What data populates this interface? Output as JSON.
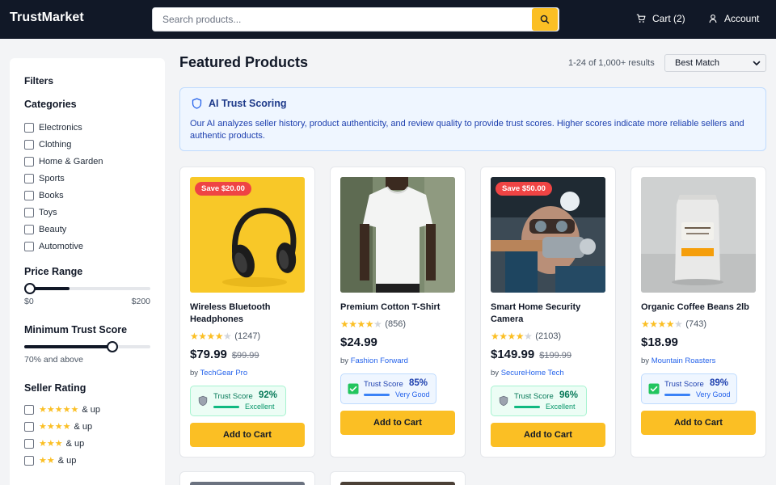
{
  "header": {
    "logo": "TrustMarket",
    "search_placeholder": "Search products...",
    "cart_label": "Cart (2)",
    "account_label": "Account"
  },
  "sidebar": {
    "title": "Filters",
    "categories_title": "Categories",
    "categories": [
      "Electronics",
      "Clothing",
      "Home & Garden",
      "Sports",
      "Books",
      "Toys",
      "Beauty",
      "Automotive"
    ],
    "price_title": "Price Range",
    "price_min": "$0",
    "price_max": "$200",
    "price_fraction": 0.36,
    "trust_title": "Minimum Trust Score",
    "trust_label": "70% and above",
    "trust_fraction": 0.7,
    "rating_title": "Seller Rating",
    "ratings": [
      {
        "stars": 5,
        "label": "& up"
      },
      {
        "stars": 4,
        "label": "& up"
      },
      {
        "stars": 3,
        "label": "& up"
      },
      {
        "stars": 2,
        "label": "& up"
      }
    ]
  },
  "main": {
    "title": "Featured Products",
    "results": "1-24 of 1,000+ results",
    "sort_value": "Best Match",
    "banner_title": "AI Trust Scoring",
    "banner_text": "Our AI analyzes seller history, product authenticity, and review quality to provide trust scores. Higher scores indicate more reliable sellers and authentic products."
  },
  "products": [
    {
      "name": "Wireless Bluetooth Headphones",
      "badge": "Save $20.00",
      "rating": 4,
      "reviews": "(1247)",
      "price": "$79.99",
      "was": "$99.99",
      "seller_prefix": "by",
      "seller": "TechGear Pro",
      "trust_label": "Trust Score",
      "trust": "92%",
      "trust_level": "Excellent",
      "trust_color": "green",
      "button": "Add to Cart"
    },
    {
      "name": "Premium Cotton T-Shirt",
      "badge": "",
      "rating": 4,
      "reviews": "(856)",
      "price": "$24.99",
      "was": "",
      "seller_prefix": "by",
      "seller": "Fashion Forward",
      "trust_label": "Trust Score",
      "trust": "85%",
      "trust_level": "Very Good",
      "trust_color": "blue",
      "button": "Add to Cart"
    },
    {
      "name": "Smart Home Security Camera",
      "badge": "Save $50.00",
      "rating": 4,
      "reviews": "(2103)",
      "price": "$149.99",
      "was": "$199.99",
      "seller_prefix": "by",
      "seller": "SecureHome Tech",
      "trust_label": "Trust Score",
      "trust": "96%",
      "trust_level": "Excellent",
      "trust_color": "green",
      "button": "Add to Cart"
    },
    {
      "name": "Organic Coffee Beans 2lb",
      "badge": "",
      "rating": 4,
      "reviews": "(743)",
      "price": "$18.99",
      "was": "",
      "seller_prefix": "by",
      "seller": "Mountain Roasters",
      "trust_label": "Trust Score",
      "trust": "89%",
      "trust_level": "Very Good",
      "trust_color": "blue",
      "button": "Add to Cart"
    }
  ]
}
